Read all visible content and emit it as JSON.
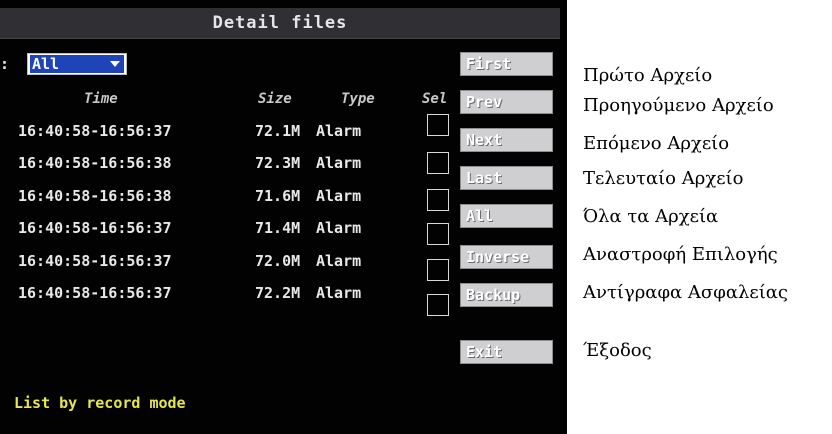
{
  "dialog": {
    "title": "Detail files",
    "filter_label_partial": ":",
    "filter_value": "All",
    "columns": {
      "time": "Time",
      "size": "Size",
      "type": "Type",
      "select": "Sel"
    },
    "rows": [
      {
        "time": "16:40:58-16:56:37",
        "size": "72.1M",
        "type": "Alarm",
        "selected": false
      },
      {
        "time": "16:40:58-16:56:38",
        "size": "72.3M",
        "type": "Alarm",
        "selected": false
      },
      {
        "time": "16:40:58-16:56:38",
        "size": "71.6M",
        "type": "Alarm",
        "selected": false
      },
      {
        "time": "16:40:58-16:56:37",
        "size": "71.4M",
        "type": "Alarm",
        "selected": false
      },
      {
        "time": "16:40:58-16:56:37",
        "size": "72.0M",
        "type": "Alarm",
        "selected": false
      },
      {
        "time": "16:40:58-16:56:37",
        "size": "72.2M",
        "type": "Alarm",
        "selected": false
      }
    ],
    "buttons": {
      "first": "First",
      "prev": "Prev",
      "next": "Next",
      "last": "Last",
      "all": "All",
      "inverse": "Inverse",
      "backup": "Backup",
      "exit": "Exit"
    },
    "status_text": "List by record mode"
  },
  "translations": {
    "first": "Πρώτο Αρχείο",
    "prev": "Προηγούμενο Αρχείο",
    "next": "Επόμενο Αρχείο",
    "last": "Τελευταίο Αρχείο",
    "all": "Όλα τα Αρχεία",
    "inverse": "Αναστροφή Επιλογής",
    "backup": "Αντίγραφα Ασφαλείας",
    "exit": "Έξοδος"
  },
  "colors": {
    "panel_bg": "#020203",
    "title_bar": "#2f2f34",
    "select_highlight": "#1f44b7",
    "button_face": "#cfcfd2",
    "status_text": "#e6e650"
  }
}
